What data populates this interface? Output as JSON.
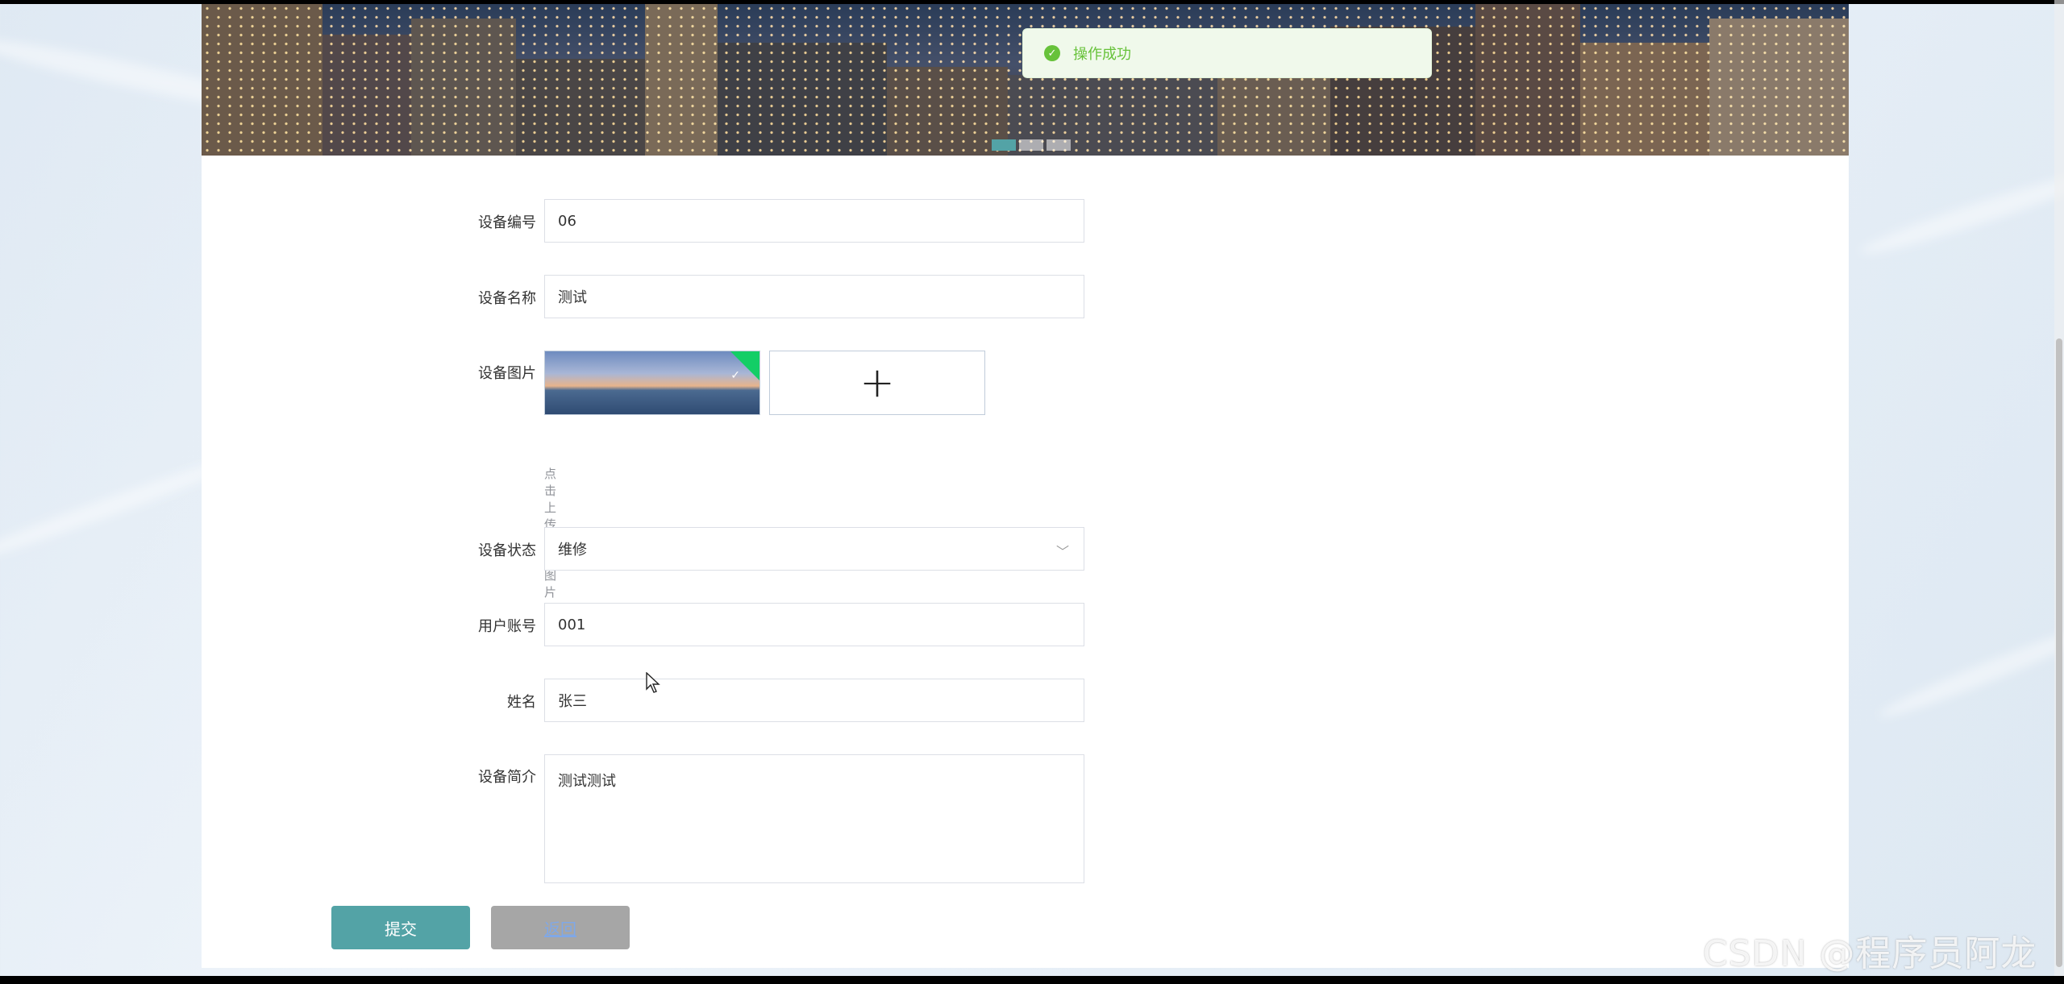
{
  "toast": {
    "icon": "check-circle-icon",
    "message": "操作成功"
  },
  "banner": {
    "slide_count": 3,
    "active_slide": 1
  },
  "form": {
    "device_no": {
      "label": "设备编号",
      "value": "06"
    },
    "device_name": {
      "label": "设备名称",
      "value": "测试"
    },
    "device_image": {
      "label": "设备图片",
      "tip": "点击上传设备图片"
    },
    "device_status": {
      "label": "设备状态",
      "value": "维修"
    },
    "user_account": {
      "label": "用户账号",
      "value": "001"
    },
    "name": {
      "label": "姓名",
      "value": "张三"
    },
    "device_intro": {
      "label": "设备简介",
      "value": "测试测试"
    }
  },
  "buttons": {
    "submit": "提交",
    "back": "返回"
  },
  "watermark": "CSDN @程序员阿龙",
  "colors": {
    "accent": "#53a3a6",
    "success": "#67c23a",
    "back_button": "#a6a6a6"
  }
}
